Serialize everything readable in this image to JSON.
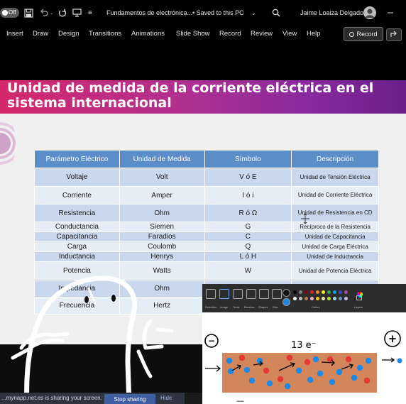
{
  "titlebar": {
    "autosave_label": "Off",
    "doc_title": "Fundamentos de electrónica...",
    "save_status": "• Saved to this PC",
    "user_name": "Jaime Loaiza Delgado"
  },
  "ribbon": {
    "tabs": [
      "Insert",
      "Draw",
      "Design",
      "Transitions",
      "Animations",
      "Slide Show",
      "Record",
      "Review",
      "View",
      "Help"
    ],
    "record_label": "Record"
  },
  "slide": {
    "title": "Unidad de medida de la corriente eléctrica en el sistema internacional",
    "headers": [
      "Parámetro Eléctrico",
      "Unidad de Medida",
      "Símbolo",
      "Descripción"
    ],
    "rows": [
      [
        "Voltaje",
        "Volt",
        "V ó E",
        "Unidad de Tensión Eléctrica"
      ],
      [
        "Corriente",
        "Amper",
        "I ó i",
        "Unidad de Corriente Eléctrica"
      ],
      [
        "Resistencia",
        "Ohm",
        "R ó Ω",
        "Unidad de Resistencia en CD"
      ],
      [
        "Conductancia",
        "Siemen",
        "G",
        "Recíproco de la Resistencia"
      ],
      [
        "Capacitancia",
        "Faradios",
        "C",
        "Unidad de Capacitancia"
      ],
      [
        "Carga",
        "Coulomb",
        "Q",
        "Unidad de Carga Eléctrica"
      ],
      [
        "Inductancia",
        "Henrys",
        "L ó H",
        "Unidad de Inductancia"
      ],
      [
        "Potencia",
        "Watts",
        "W",
        "Unidad de Potencia Eléctrica"
      ],
      [
        "Impedancia",
        "Ohm",
        "",
        ""
      ],
      [
        "Frecuencia",
        "Hertz",
        "",
        ""
      ]
    ]
  },
  "paint": {
    "tool_labels": [
      "Selection",
      "Image",
      "Tools",
      "Brushes",
      "Shapes",
      "Size"
    ],
    "colors_label": "Colors",
    "layers_label": "Layers",
    "drawing": {
      "minus_sign": "−",
      "plus_sign": "+",
      "electron_label": "13 e⁻",
      "bottom_mark": "—",
      "colors": {
        "wire_fill": "#d2865a",
        "electron": "#1e88e5",
        "ion": "#e53935"
      }
    }
  },
  "sharing": {
    "message": "...mynapp.net.es is sharing your screen.",
    "stop_label": "Stop sharing",
    "hide_label": "Hide"
  },
  "colors": {
    "title_gradient_start": "#d4286b",
    "title_gradient_end": "#6a1f8a",
    "table_header": "#5b8dc9"
  }
}
